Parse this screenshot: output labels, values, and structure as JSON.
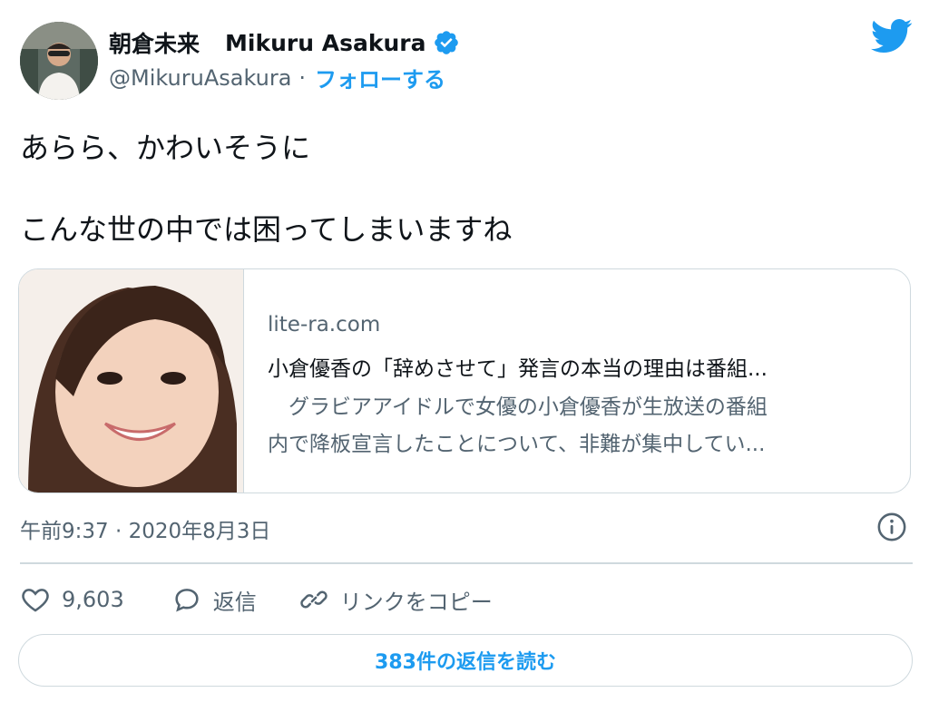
{
  "author": {
    "display_name_jp": "朝倉未来",
    "display_name_en": "Mikuru Asakura",
    "handle": "@MikuruAsakura",
    "separator": "·",
    "follow_label": "フォローする",
    "verified": true
  },
  "tweet": {
    "line1": "あらら、かわいそうに",
    "line2": "こんな世の中では困ってしまいますね"
  },
  "card": {
    "domain": "lite-ra.com",
    "title": "小倉優香の「辞めさせて」発言の本当の理由は番組...",
    "desc_line1": "　グラビアアイドルで女優の小倉優香が生放送の番組",
    "desc_line2": "内で降板宣言したことについて、非難が集中してい..."
  },
  "meta": {
    "timestamp": "午前9:37 · 2020年8月3日"
  },
  "actions": {
    "likes": "9,603",
    "reply_label": "返信",
    "copy_link_label": "リンクをコピー"
  },
  "replies_button": "383件の返信を読む",
  "icons": {
    "verified": "verified-badge-icon",
    "brand": "twitter-bird-icon",
    "info": "info-icon",
    "like": "heart-icon",
    "reply": "reply-bubble-icon",
    "link": "link-icon"
  },
  "colors": {
    "accent": "#1d9bf0",
    "text": "#0f1419",
    "muted": "#536471",
    "border": "#cfd9de"
  }
}
